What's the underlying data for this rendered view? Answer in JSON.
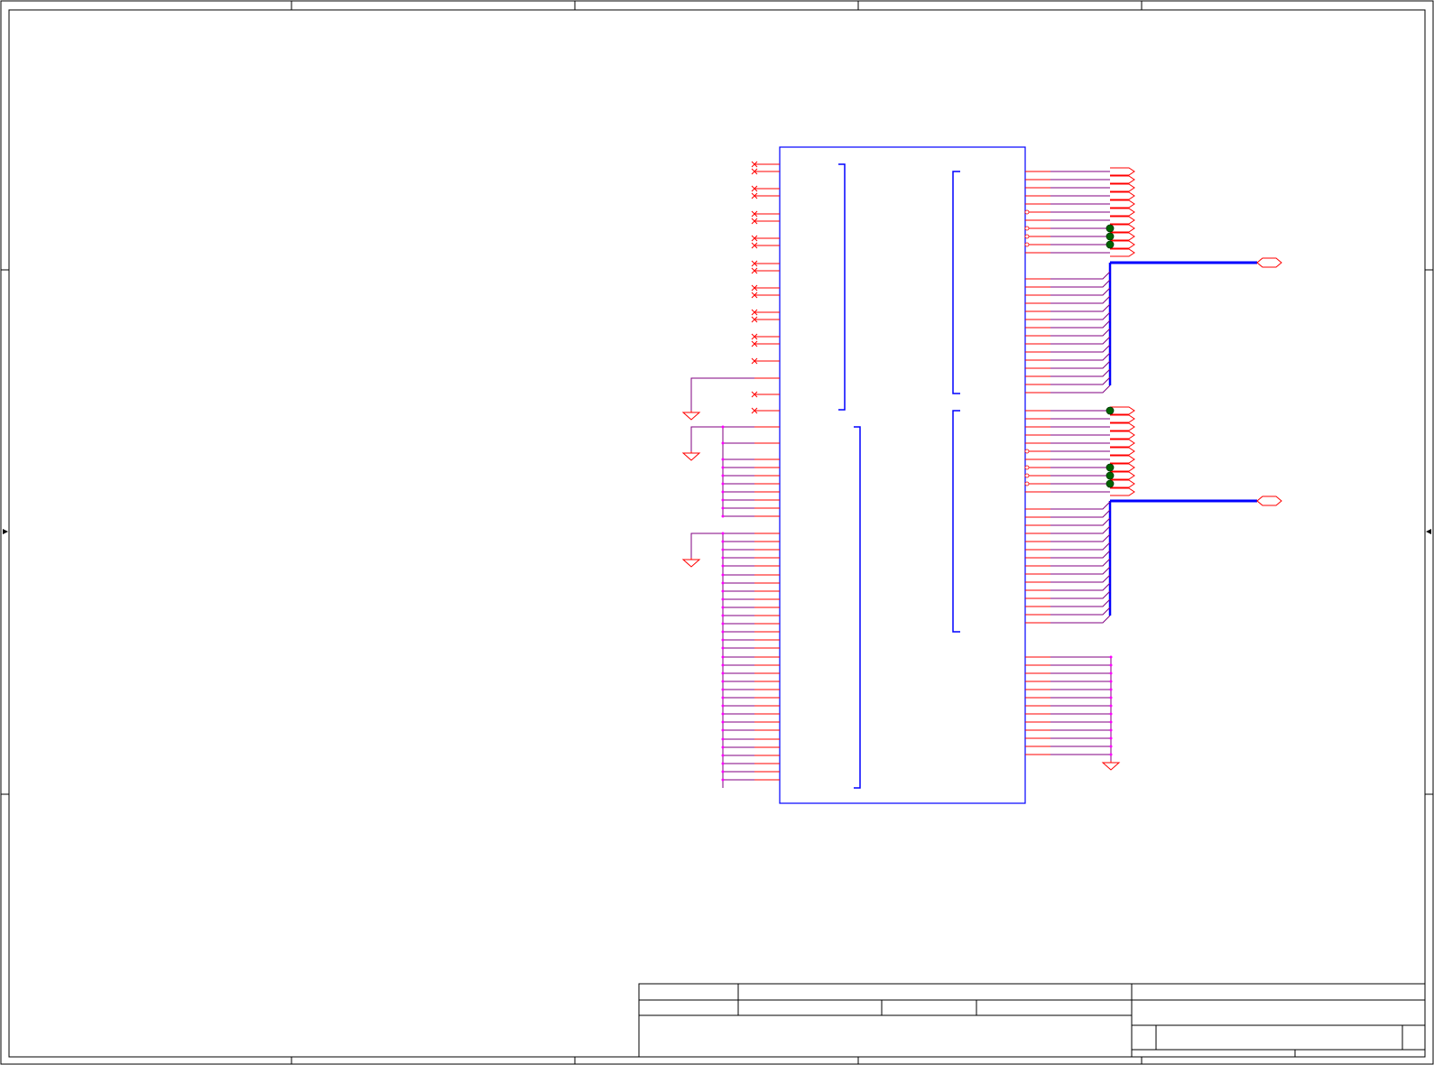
{
  "sheet": {
    "title_block": {
      "cells": [
        "",
        "",
        "",
        "",
        "",
        "",
        "",
        "",
        "",
        "",
        "",
        ""
      ]
    }
  },
  "colors": {
    "frame": "#000000",
    "component": "#0000ff",
    "pin": "#ff0000",
    "wire": "#800080",
    "bus": "#0000ff",
    "pin_stub_dot": "#ff00ff",
    "junction": "#006400",
    "power_symbol": "#ff0000",
    "port": "#ff0000"
  },
  "icons": {
    "ground": "ground-symbol-icon",
    "no_connect": "no-connect-x-icon",
    "port": "hex-port-icon",
    "junction": "junction-dot-icon"
  },
  "symbols": {
    "ground_count": 4,
    "bus_port_count": 2,
    "output_port_count": 22
  }
}
